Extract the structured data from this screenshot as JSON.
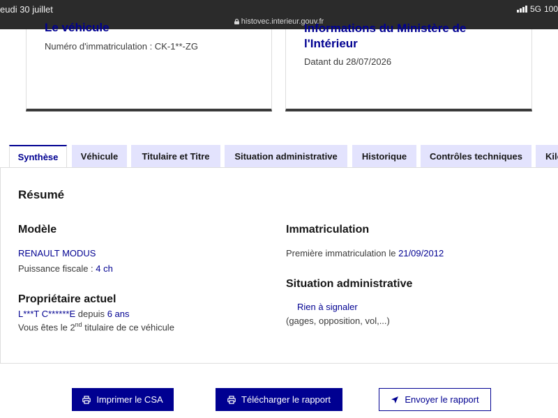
{
  "status_bar": {
    "date": "eudi 30 juillet",
    "url": "histovec.interieur.gouv.fr",
    "network": "5G",
    "battery": "100"
  },
  "cards": {
    "left": {
      "title": "Le véhicule",
      "plate_label": "Numéro d'immatriculation : CK-1**-ZG"
    },
    "right": {
      "title_line1": "Informations du Ministère de",
      "title_line2": "l'Intérieur",
      "date_text": "Datant du 28/07/2026"
    }
  },
  "tabs": [
    {
      "label": "Synthèse",
      "active": true
    },
    {
      "label": "Véhicule",
      "active": false
    },
    {
      "label": "Titulaire et Titre",
      "active": false
    },
    {
      "label": "Situation administrative",
      "active": false
    },
    {
      "label": "Historique",
      "active": false
    },
    {
      "label": "Contrôles techniques",
      "active": false
    },
    {
      "label": "Kilo",
      "active": false
    }
  ],
  "summary": {
    "heading": "Résumé",
    "model": {
      "heading": "Modèle",
      "name": "RENAULT MODUS",
      "power_label": "Puissance fiscale : ",
      "power_value": "4 ch"
    },
    "owner": {
      "heading": "Propriétaire actuel",
      "name": "L***T C******E",
      "since_label": " depuis ",
      "since_value": "6 ans",
      "rank_prefix": "Vous êtes le 2",
      "rank_sup": "nd",
      "rank_suffix": " titulaire de ce véhicule"
    },
    "registration": {
      "heading": "Immatriculation",
      "first_label": "Première immatriculation le ",
      "first_date": "21/09/2012"
    },
    "admin": {
      "heading": "Situation administrative",
      "status": "Rien à signaler",
      "detail": "(gages, opposition, vol,...)"
    }
  },
  "actions": {
    "print": "Imprimer le CSA",
    "download": "Télécharger le rapport",
    "send": "Envoyer le rapport"
  },
  "colors": {
    "primary": "#000091",
    "tab_bg": "#e3e3fd",
    "status_bar": "#2b2b2b"
  }
}
